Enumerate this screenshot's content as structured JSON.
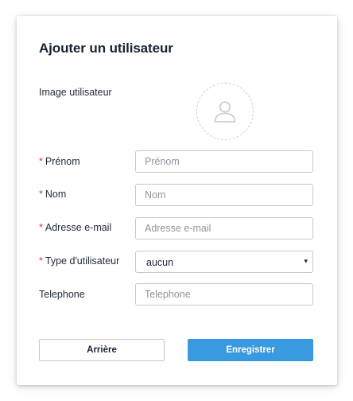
{
  "dialog": {
    "title": "Ajouter un utilisateur"
  },
  "image": {
    "label": "Image utilisateur",
    "icon": "user-avatar-icon"
  },
  "fields": {
    "required_marker": "*",
    "first_name": {
      "label": "Prénom",
      "placeholder": "Prénom",
      "value": ""
    },
    "last_name": {
      "label": "Nom",
      "placeholder": "Nom",
      "value": ""
    },
    "email": {
      "label": "Adresse e-mail",
      "placeholder": "Adresse e-mail",
      "value": ""
    },
    "user_type": {
      "label": "Type d'utilisateur",
      "value": "aucun",
      "caret": "▾"
    },
    "phone": {
      "label": "Telephone",
      "placeholder": "Telephone",
      "value": ""
    }
  },
  "actions": {
    "back_label": "Arrière",
    "save_label": "Enregistrer"
  },
  "colors": {
    "accent": "#3a9ae0",
    "required": "#e0313b",
    "border": "#c3c8d0"
  }
}
